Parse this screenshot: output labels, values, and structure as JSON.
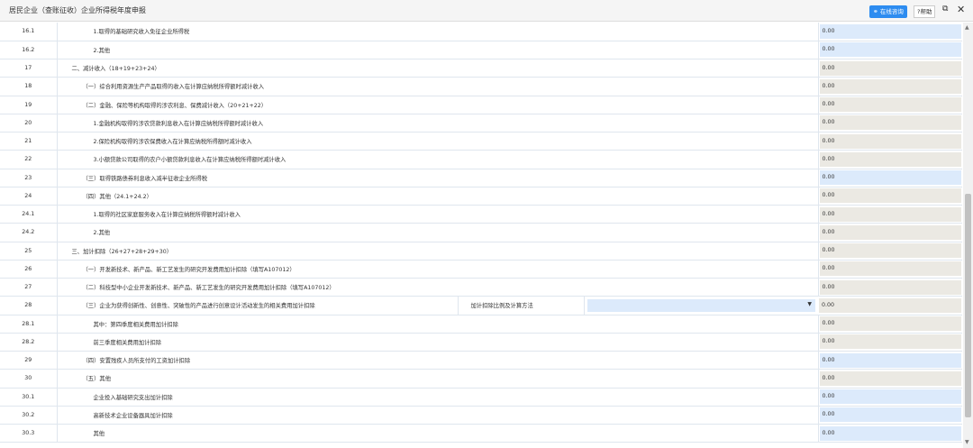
{
  "header": {
    "title": "居民企业（查账征收）企业所得税年度申报",
    "online_btn": "在线咨询",
    "help_btn": "?帮助"
  },
  "rows": [
    {
      "no": "16.1",
      "desc": "1.取得的基础研究收入免征企业所得税",
      "value": "0.00",
      "level": 3,
      "editable": true
    },
    {
      "no": "16.2",
      "desc": "2.其他",
      "value": "0.00",
      "level": 3,
      "editable": true
    },
    {
      "no": "17",
      "desc": "二、减计收入（18+19+23+24）",
      "value": "0.00",
      "level": 1,
      "editable": false
    },
    {
      "no": "18",
      "desc": "（一）综合利用资源生产产品取得的收入在计算应纳税所得额时减计收入",
      "value": "0.00",
      "level": 2,
      "editable": false
    },
    {
      "no": "19",
      "desc": "（二）金融、保险等机构取得的涉农利息、保费减计收入（20+21+22）",
      "value": "0.00",
      "level": 2,
      "editable": false
    },
    {
      "no": "20",
      "desc": "1.金融机构取得的涉农贷款利息收入在计算应纳税所得额时减计收入",
      "value": "0.00",
      "level": 3,
      "editable": false
    },
    {
      "no": "21",
      "desc": "2.保险机构取得的涉农保费收入在计算应纳税所得额时减计收入",
      "value": "0.00",
      "level": 3,
      "editable": false
    },
    {
      "no": "22",
      "desc": "3.小额贷款公司取得的农户小额贷款利息收入在计算应纳税所得额时减计收入",
      "value": "0.00",
      "level": 3,
      "editable": false
    },
    {
      "no": "23",
      "desc": "（三）取得铁路债券利息收入减半征收企业所得税",
      "value": "0.00",
      "level": 2,
      "editable": true
    },
    {
      "no": "24",
      "desc": "（四）其他（24.1+24.2）",
      "value": "0.00",
      "level": 2,
      "editable": false
    },
    {
      "no": "24.1",
      "desc": "1.取得的社区家庭服务收入在计算应纳税所得额时减计收入",
      "value": "0.00",
      "level": 3,
      "editable": false
    },
    {
      "no": "24.2",
      "desc": "2.其他",
      "value": "0.00",
      "level": 3,
      "editable": false
    },
    {
      "no": "25",
      "desc": "三、加计扣除（26+27+28+29+30）",
      "value": "0.00",
      "level": 1,
      "editable": false
    },
    {
      "no": "26",
      "desc": "（一）开发新技术、新产品、新工艺发生的研究开发费用加计扣除（填写A107012）",
      "value": "0.00",
      "level": 2,
      "editable": false
    },
    {
      "no": "27",
      "desc": "（二）科技型中小企业开发新技术、新产品、新工艺发生的研究开发费用加计扣除（填写A107012）",
      "value": "0.00",
      "level": 2,
      "editable": false
    },
    {
      "no": "28",
      "desc": "（三）企业为获得创新性、创意性、突破性的产品进行创意设计活动发生的相关费用加计扣除",
      "value": "0.00",
      "level": 2,
      "editable": false,
      "extra_label": "加计扣除比例及计算方法",
      "extra_select": ""
    },
    {
      "no": "28.1",
      "desc": "其中：第四季度相关费用加计扣除",
      "value": "0.00",
      "level": 3,
      "editable": false
    },
    {
      "no": "28.2",
      "desc": "前三季度相关费用加计扣除",
      "value": "0.00",
      "level": 3,
      "editable": false
    },
    {
      "no": "29",
      "desc": "（四）安置残疾人员所支付的工资加计扣除",
      "value": "0.00",
      "level": 2,
      "editable": true
    },
    {
      "no": "30",
      "desc": "（五）其他",
      "value": "0.00",
      "level": 2,
      "editable": false
    },
    {
      "no": "30.1",
      "desc": "企业投入基础研究支出加计扣除",
      "value": "0.00",
      "level": 3,
      "editable": true
    },
    {
      "no": "30.2",
      "desc": "高新技术企业设备器具加计扣除",
      "value": "0.00",
      "level": 3,
      "editable": true
    },
    {
      "no": "30.3",
      "desc": "其他",
      "value": "0.00",
      "level": 3,
      "editable": true
    }
  ],
  "colors": {
    "editable": "#dceafb",
    "readonly": "#ebe9e3",
    "accent": "#2d8cf0"
  }
}
